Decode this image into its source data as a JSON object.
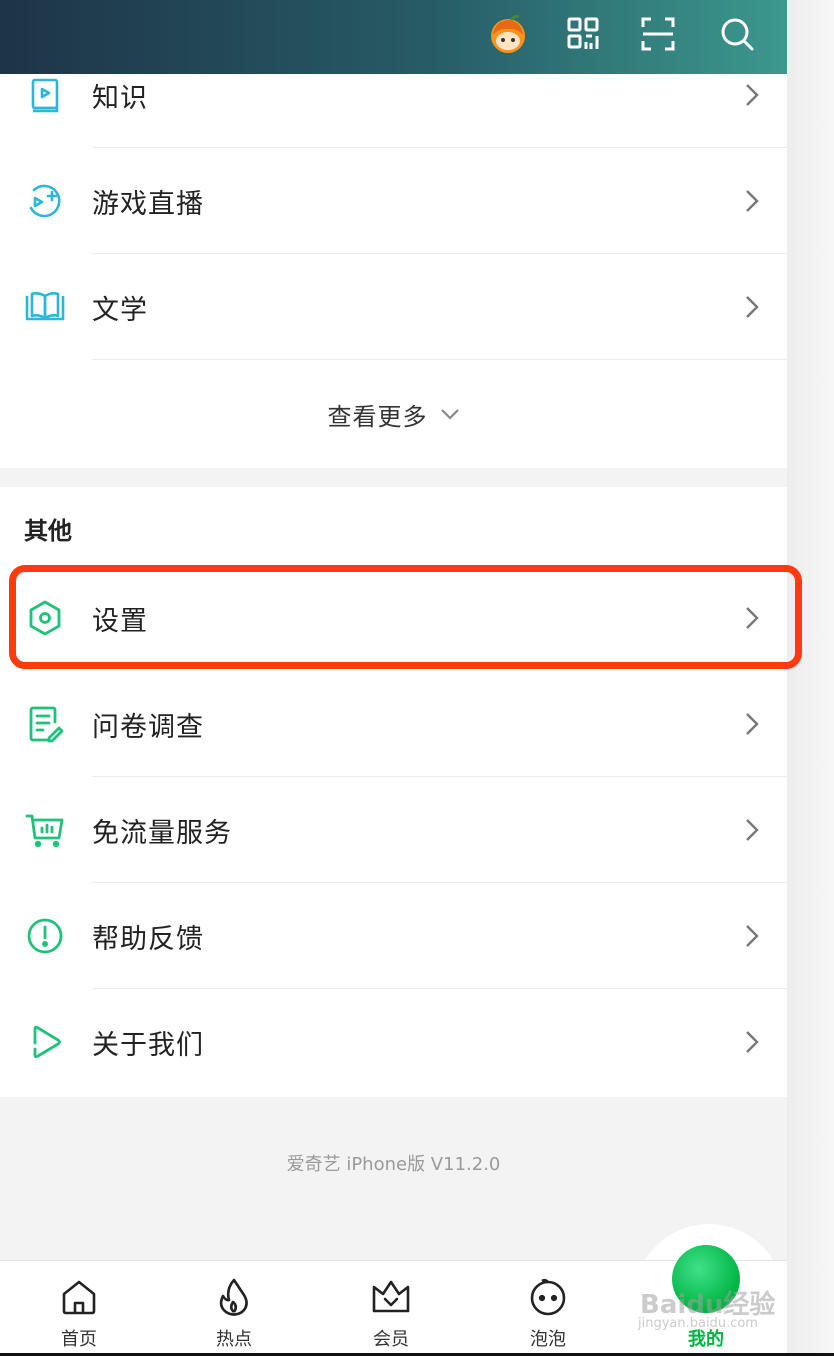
{
  "header": {
    "icons": [
      "avatar-icon",
      "qr-code-icon",
      "scan-icon",
      "search-icon"
    ]
  },
  "top_menu": {
    "items": [
      {
        "label": "知识",
        "icon": "book-play-icon"
      },
      {
        "label": "游戏直播",
        "icon": "game-play-icon"
      },
      {
        "label": "文学",
        "icon": "open-book-icon"
      }
    ],
    "more_label": "查看更多"
  },
  "other": {
    "title": "其他",
    "items": [
      {
        "label": "设置",
        "icon": "settings-hex-icon"
      },
      {
        "label": "问卷调查",
        "icon": "survey-icon"
      },
      {
        "label": "免流量服务",
        "icon": "cart-icon"
      },
      {
        "label": "帮助反馈",
        "icon": "help-icon"
      },
      {
        "label": "关于我们",
        "icon": "about-play-icon"
      }
    ]
  },
  "version_text": "爱奇艺 iPhone版 V11.2.0",
  "tabbar": {
    "tabs": [
      {
        "label": "首页",
        "icon": "home-icon"
      },
      {
        "label": "热点",
        "icon": "fire-icon"
      },
      {
        "label": "会员",
        "icon": "crown-icon"
      },
      {
        "label": "泡泡",
        "icon": "bubble-face-icon"
      },
      {
        "label": "我的",
        "icon": "mine-icon",
        "active": true
      }
    ]
  },
  "watermark": {
    "line1": "Baidu经验",
    "line2": "jingyan.baidu.com"
  },
  "colors": {
    "accent": "#00b441",
    "highlight": "#ff3a0f"
  }
}
